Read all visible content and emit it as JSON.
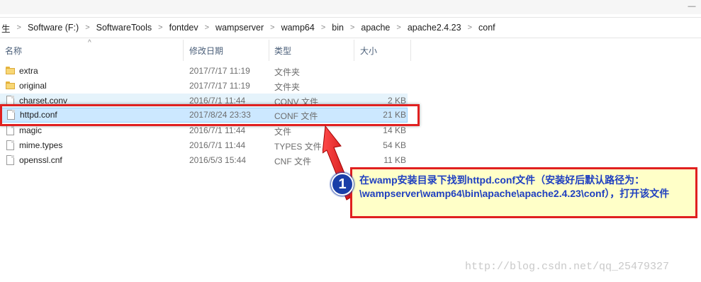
{
  "window": {
    "minimize_glyph": "—"
  },
  "breadcrumb": {
    "items": [
      "生",
      "Software (F:)",
      "SoftwareTools",
      "fontdev",
      "wampserver",
      "wamp64",
      "bin",
      "apache",
      "apache2.4.23",
      "conf"
    ],
    "separator": ">"
  },
  "columns": {
    "name": "名称",
    "modified": "修改日期",
    "type": "类型",
    "size": "大小",
    "sort_indicator": "^"
  },
  "files": [
    {
      "name": "extra",
      "modified": "2017/7/17 11:19",
      "type": "文件夹",
      "size": "",
      "icon": "folder-icon"
    },
    {
      "name": "original",
      "modified": "2017/7/17 11:19",
      "type": "文件夹",
      "size": "",
      "icon": "folder-icon"
    },
    {
      "name": "charset.conv",
      "modified": "2016/7/1 11:44",
      "type": "CONV 文件",
      "size": "2 KB",
      "icon": "file-icon"
    },
    {
      "name": "httpd.conf",
      "modified": "2017/8/24 23:33",
      "type": "CONF 文件",
      "size": "21 KB",
      "icon": "file-icon"
    },
    {
      "name": "magic",
      "modified": "2016/7/1 11:44",
      "type": "文件",
      "size": "14 KB",
      "icon": "file-icon"
    },
    {
      "name": "mime.types",
      "modified": "2016/7/1 11:44",
      "type": "TYPES 文件",
      "size": "54 KB",
      "icon": "file-icon"
    },
    {
      "name": "openssl.cnf",
      "modified": "2016/5/3 15:44",
      "type": "CNF 文件",
      "size": "11 KB",
      "icon": "file-icon"
    }
  ],
  "annotation": {
    "step_number": "1",
    "text": "在wamp安装目录下找到httpd.conf文件（安装好后默认路径为：\\wampserver\\wamp64\\bin\\apache\\apache2.4.23\\conf），打开该文件",
    "colors": {
      "border": "#e02020",
      "fill": "#ffffc8",
      "text": "#1f3fc0",
      "badge": "#1a3ea8"
    }
  },
  "watermark": "http://blog.csdn.net/qq_25479327"
}
